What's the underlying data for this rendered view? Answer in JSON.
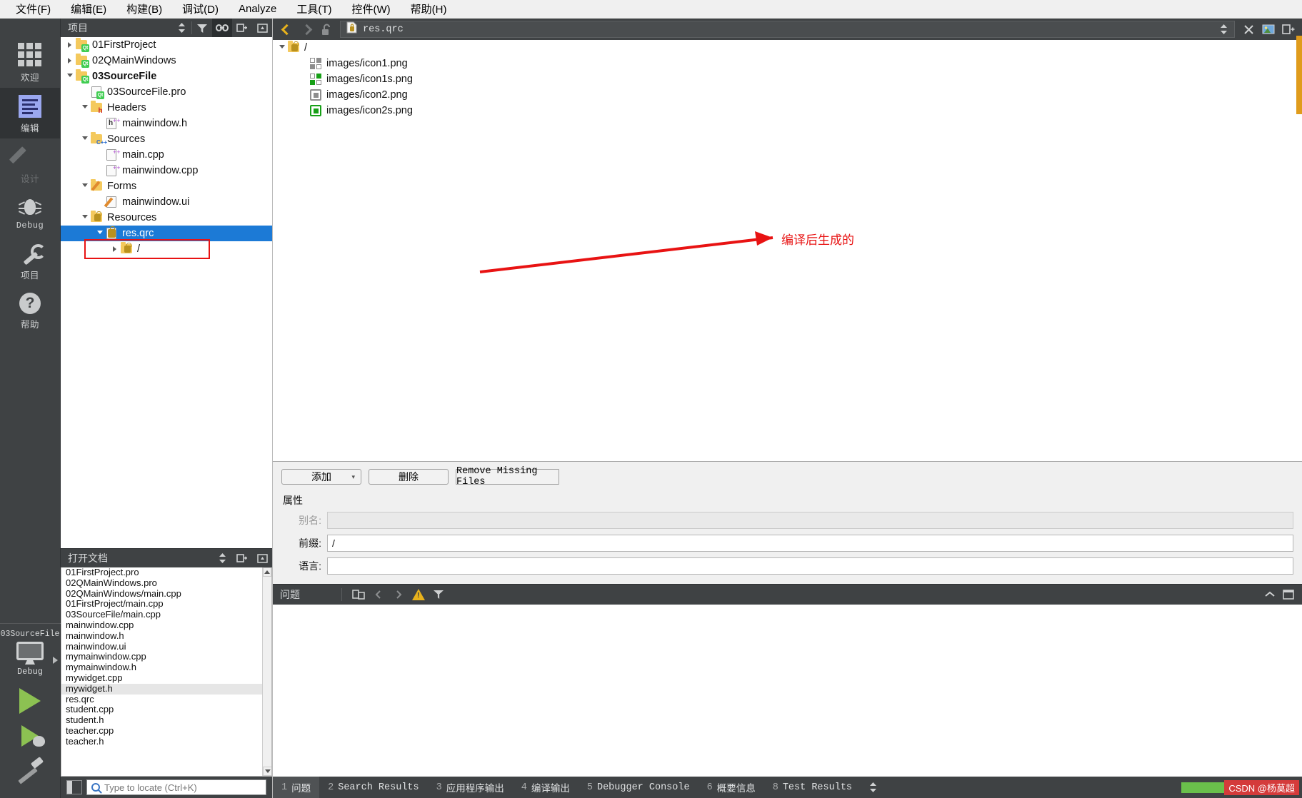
{
  "menubar": {
    "items": [
      {
        "label": "文件(F)"
      },
      {
        "label": "编辑(E)"
      },
      {
        "label": "构建(B)"
      },
      {
        "label": "调试(D)"
      },
      {
        "label": "Analyze"
      },
      {
        "label": "工具(T)"
      },
      {
        "label": "控件(W)"
      },
      {
        "label": "帮助(H)"
      }
    ]
  },
  "modebar": {
    "modes": [
      {
        "label": "欢迎",
        "icon": "grid-icon",
        "state": "normal"
      },
      {
        "label": "编辑",
        "icon": "edit-lines-icon",
        "state": "active"
      },
      {
        "label": "设计",
        "icon": "pencil-icon",
        "state": "disabled"
      },
      {
        "label": "Debug",
        "icon": "bug-icon",
        "state": "normal"
      },
      {
        "label": "项目",
        "icon": "wrench-icon",
        "state": "normal"
      },
      {
        "label": "帮助",
        "icon": "question-mark-icon",
        "state": "normal"
      }
    ],
    "kit": {
      "project": "03SourceFile",
      "config": "Debug",
      "icon": "desktop-monitor-icon"
    },
    "actions": [
      {
        "name": "run",
        "icon": "green-play-triangle-icon"
      },
      {
        "name": "debug",
        "icon": "play-with-bug-icon"
      },
      {
        "name": "build",
        "icon": "hammer-icon"
      }
    ]
  },
  "project_panel": {
    "title": "项目",
    "toolbar": [
      {
        "name": "filter",
        "icon": "funnel-icon"
      },
      {
        "name": "sync-with-editor",
        "icon": "link-icon",
        "active": true
      },
      {
        "name": "split",
        "icon": "split-icon"
      }
    ],
    "tree": [
      {
        "label": "01FirstProject",
        "depth": 0,
        "icon": "qt-folder-icon",
        "state": "collapsed",
        "bold": false,
        "selected": false
      },
      {
        "label": "02QMainWindows",
        "depth": 0,
        "icon": "qt-folder-icon",
        "state": "collapsed",
        "bold": false,
        "selected": false
      },
      {
        "label": "03SourceFile",
        "depth": 0,
        "icon": "qt-folder-icon",
        "state": "expanded",
        "bold": true,
        "selected": false
      },
      {
        "label": "03SourceFile.pro",
        "depth": 1,
        "icon": "qt-pro-file-icon",
        "state": "leaf",
        "bold": false,
        "selected": false
      },
      {
        "label": "Headers",
        "depth": 1,
        "icon": "headers-folder-icon",
        "state": "expanded",
        "bold": false,
        "selected": false
      },
      {
        "label": "mainwindow.h",
        "depth": 2,
        "icon": "header-file-icon",
        "state": "leaf",
        "bold": false,
        "selected": false
      },
      {
        "label": "Sources",
        "depth": 1,
        "icon": "sources-folder-icon",
        "state": "expanded",
        "bold": false,
        "selected": false
      },
      {
        "label": "main.cpp",
        "depth": 2,
        "icon": "cpp-file-icon",
        "state": "leaf",
        "bold": false,
        "selected": false
      },
      {
        "label": "mainwindow.cpp",
        "depth": 2,
        "icon": "cpp-file-icon",
        "state": "leaf",
        "bold": false,
        "selected": false
      },
      {
        "label": "Forms",
        "depth": 1,
        "icon": "forms-folder-icon",
        "state": "expanded",
        "bold": false,
        "selected": false
      },
      {
        "label": "mainwindow.ui",
        "depth": 2,
        "icon": "ui-file-icon",
        "state": "leaf",
        "bold": false,
        "selected": false
      },
      {
        "label": "Resources",
        "depth": 1,
        "icon": "resource-folder-icon",
        "state": "expanded",
        "bold": false,
        "selected": false
      },
      {
        "label": "res.qrc",
        "depth": 2,
        "icon": "qrc-file-icon",
        "state": "expanded",
        "bold": false,
        "selected": true
      },
      {
        "label": "/",
        "depth": 3,
        "icon": "prefix-folder-icon",
        "state": "collapsed",
        "bold": false,
        "selected": false
      }
    ]
  },
  "open_documents": {
    "title": "打开文档",
    "toolbar": [
      {
        "name": "sort",
        "icon": "updown-arrows-icon"
      },
      {
        "name": "split",
        "icon": "split-icon"
      },
      {
        "name": "close",
        "icon": "close-pane-icon"
      }
    ],
    "files": [
      {
        "label": "01FirstProject.pro",
        "highlight": false
      },
      {
        "label": "02QMainWindows.pro",
        "highlight": false
      },
      {
        "label": "02QMainWindows/main.cpp",
        "highlight": false
      },
      {
        "label": "01FirstProject/main.cpp",
        "highlight": false
      },
      {
        "label": "03SourceFile/main.cpp",
        "highlight": false
      },
      {
        "label": "mainwindow.cpp",
        "highlight": false
      },
      {
        "label": "mainwindow.h",
        "highlight": false
      },
      {
        "label": "mainwindow.ui",
        "highlight": false
      },
      {
        "label": "mymainwindow.cpp",
        "highlight": false
      },
      {
        "label": "mymainwindow.h",
        "highlight": false
      },
      {
        "label": "mywidget.cpp",
        "highlight": false
      },
      {
        "label": "mywidget.h",
        "highlight": true
      },
      {
        "label": "res.qrc",
        "highlight": false
      },
      {
        "label": "student.cpp",
        "highlight": false
      },
      {
        "label": "student.h",
        "highlight": false
      },
      {
        "label": "teacher.cpp",
        "highlight": false
      },
      {
        "label": "teacher.h",
        "highlight": false
      }
    ]
  },
  "locator": {
    "placeholder": "Type to locate (Ctrl+K)",
    "value": "",
    "icon": "magnifier-icon",
    "sidebar_toggle_icon": "sidebar-toggle-icon"
  },
  "editor": {
    "toolbar": {
      "back_icon": "chevron-left-icon",
      "forward_icon": "chevron-right-icon",
      "lock_icon": "unlocked-padlock-icon",
      "file_icon": "qrc-file-icon",
      "filename": "res.qrc",
      "spin_icon": "updown-arrows-icon",
      "close_icon": "close-x-icon",
      "extra_icon": "image-icon",
      "split_icon": "split-editor-icon"
    },
    "resource_tree": [
      {
        "label": "/",
        "depth": 0,
        "icon": "prefix-folder-icon",
        "state": "expanded"
      },
      {
        "label": "images/icon1.png",
        "depth": 1,
        "icon": "grey-checker-icon",
        "state": "leaf"
      },
      {
        "label": "images/icon1s.png",
        "depth": 1,
        "icon": "green-checker-icon",
        "state": "leaf"
      },
      {
        "label": "images/icon2.png",
        "depth": 1,
        "icon": "grey-chip-icon",
        "state": "leaf"
      },
      {
        "label": "images/icon2s.png",
        "depth": 1,
        "icon": "green-chip-icon",
        "state": "leaf"
      }
    ],
    "annotation": {
      "text": "编译后生成的",
      "color": "#e81313",
      "arrow_icon": "red-arrow-icon",
      "box_icon": "red-highlight-box"
    }
  },
  "resource_props": {
    "buttons": [
      {
        "label": "添加",
        "has_dropdown": true
      },
      {
        "label": "删除",
        "has_dropdown": false
      },
      {
        "label": "Remove Missing Files",
        "has_dropdown": false
      }
    ],
    "section_title": "属性",
    "fields": [
      {
        "label": "别名:",
        "value": "",
        "disabled": true
      },
      {
        "label": "前缀:",
        "value": "/",
        "disabled": false
      },
      {
        "label": "语言:",
        "value": "",
        "disabled": false
      }
    ]
  },
  "issues": {
    "title": "问题",
    "toolbar": [
      {
        "name": "copy",
        "icon": "copy-icon"
      },
      {
        "name": "prev",
        "icon": "chevron-left-icon"
      },
      {
        "name": "next",
        "icon": "chevron-right-icon"
      },
      {
        "name": "warning-filter",
        "icon": "warning-triangle-icon"
      },
      {
        "name": "filter",
        "icon": "funnel-icon"
      }
    ],
    "panel_buttons": [
      {
        "name": "collapse",
        "icon": "chevron-up-icon"
      },
      {
        "name": "maximize",
        "icon": "maximize-icon"
      }
    ]
  },
  "statusbar": {
    "panes": [
      {
        "num": "1",
        "label": "问题",
        "active": true
      },
      {
        "num": "2",
        "label": "Search Results",
        "active": false
      },
      {
        "num": "3",
        "label": "应用程序输出",
        "active": false
      },
      {
        "num": "4",
        "label": "编译输出",
        "active": false
      },
      {
        "num": "5",
        "label": "Debugger Console",
        "active": false
      },
      {
        "num": "6",
        "label": "概要信息",
        "active": false
      },
      {
        "num": "8",
        "label": "Test Results",
        "active": false
      }
    ],
    "spin_icon": "updown-arrows-icon",
    "watermark": "CSDN @杨莫超"
  },
  "colors": {
    "accent_blue": "#1c7ad6",
    "annotation_red": "#e81313",
    "dark_chrome": "#3f4244",
    "qt_green": "#41cd52"
  }
}
